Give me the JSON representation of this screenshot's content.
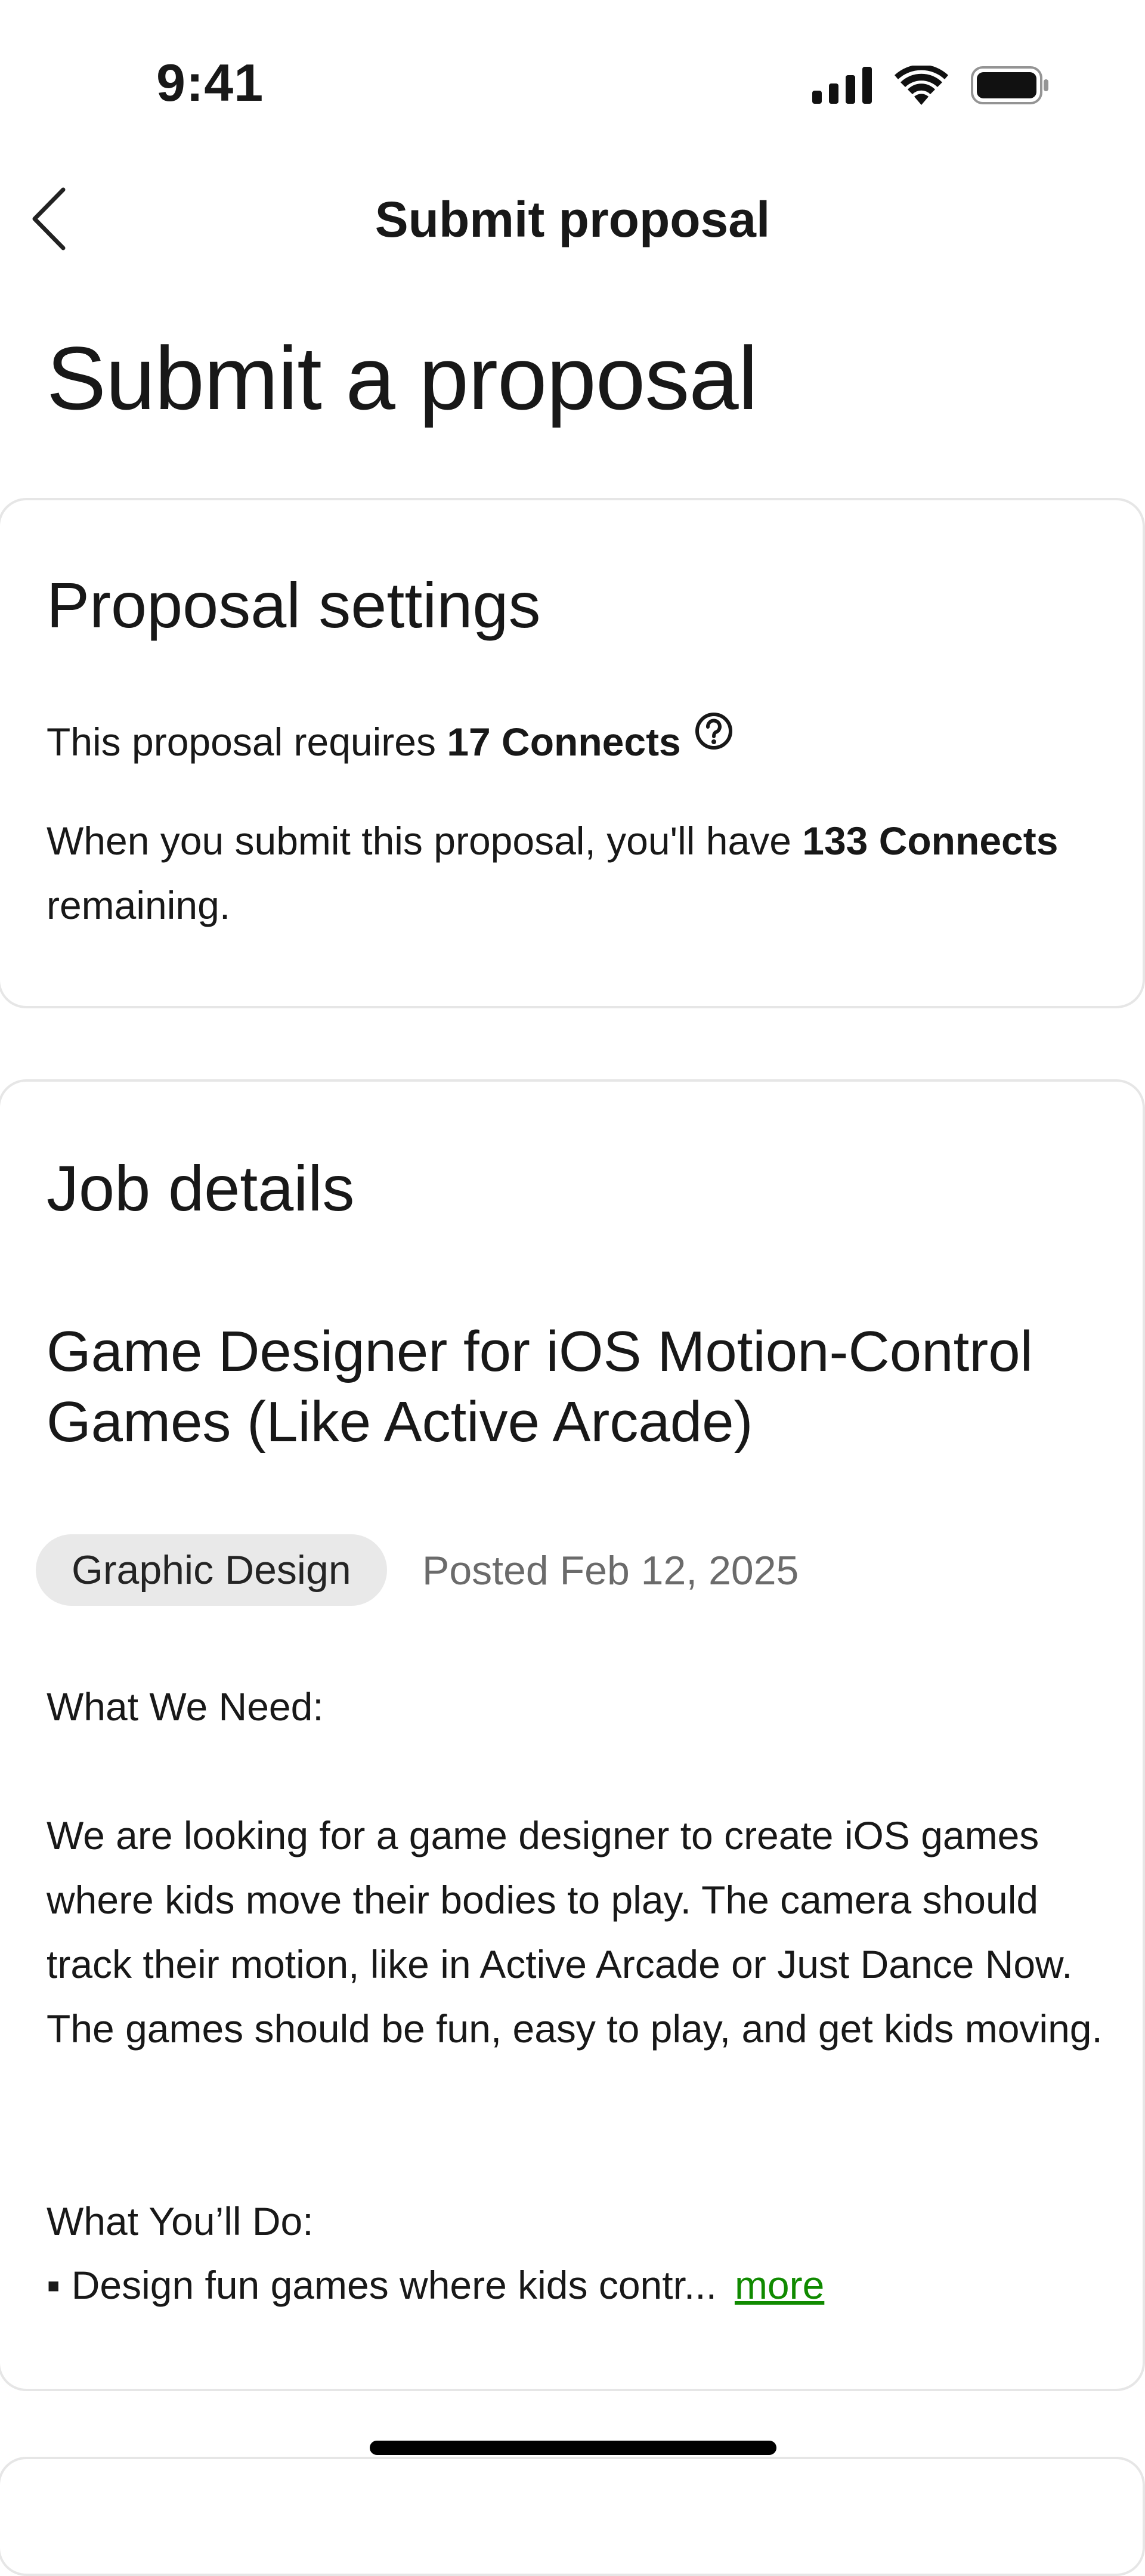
{
  "status_bar": {
    "time": "9:41"
  },
  "nav": {
    "title": "Submit proposal"
  },
  "page": {
    "title": "Submit a proposal"
  },
  "proposal_settings": {
    "heading": "Proposal settings",
    "requires_prefix": "This proposal requires ",
    "requires_value": "17 Connects",
    "remaining_prefix": "When you submit this proposal, you'll have ",
    "remaining_value": "133 Connects",
    "remaining_suffix": "remaining."
  },
  "job_details": {
    "heading": "Job details",
    "job_title": "Game Designer for iOS Motion-Control Games (Like Active Arcade)",
    "category": "Graphic Design",
    "posted": "Posted Feb 12, 2025",
    "need_heading": "What We Need:",
    "need_body": "We are looking for a game designer to create iOS games where kids move their bodies to play. The camera should track their motion, like in Active Arcade or Just Dance Now. The games should be fun, easy to play, and get kids moving.",
    "do_heading": "What You’ll Do:",
    "do_first_item": "▪ Design fun games where kids contr...",
    "more_label": "more"
  },
  "colors": {
    "accent": "#108a00",
    "chip_bg": "#e9e9e9",
    "border": "#e6e6e6"
  }
}
